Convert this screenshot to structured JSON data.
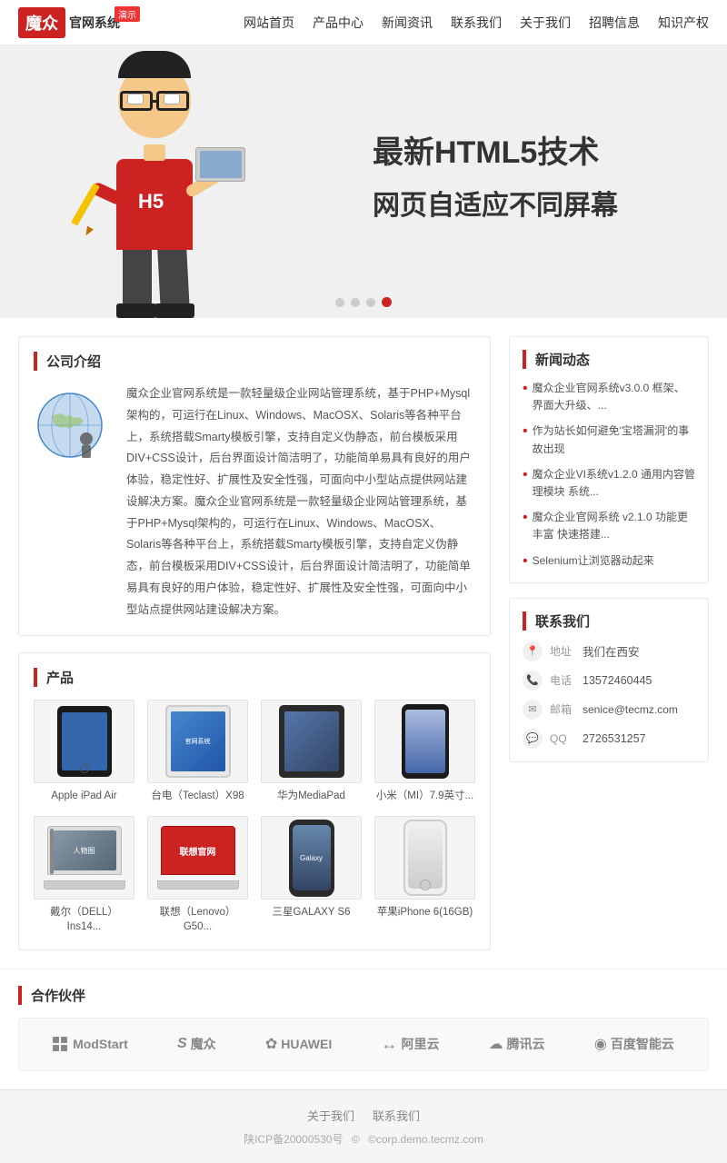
{
  "header": {
    "logo_text": "魔众",
    "logo_sub": "官网系统",
    "logo_demo": "演示",
    "nav": [
      {
        "label": "网站首页",
        "id": "home"
      },
      {
        "label": "产品中心",
        "id": "products"
      },
      {
        "label": "新闻资讯",
        "id": "news"
      },
      {
        "label": "联系我们",
        "id": "contact"
      },
      {
        "label": "关于我们",
        "id": "about"
      },
      {
        "label": "招聘信息",
        "id": "jobs"
      },
      {
        "label": "知识产权",
        "id": "ip"
      }
    ]
  },
  "hero": {
    "line1": "最新HTML5技术",
    "line2": "网页自适应不同屏幕"
  },
  "company": {
    "title": "公司介绍",
    "text": "魔众企业官网系统是一款轻量级企业网站管理系统，基于PHP+Mysql架构的，可运行在Linux、Windows、MacOSX、Solaris等各种平台上，系统搭载Smarty模板引擎，支持自定义伪静态，前台模板采用DIV+CSS设计，后台界面设计简洁明了，功能简单易具有良好的用户体验，稳定性好、扩展性及安全性强，可面向中小型站点提供网站建设解决方案。魔众企业官网系统是一款轻量级企业网站管理系统，基于PHP+Mysql架构的，可运行在Linux、Windows、MacOSX、Solaris等各种平台上，系统搭载Smarty模板引擎，支持自定义伪静态，前台模板采用DIV+CSS设计，后台界面设计简洁明了，功能简单易具有良好的用户体验，稳定性好、扩展性及安全性强，可面向中小型站点提供网站建设解决方案。"
  },
  "products_section": {
    "title": "产品",
    "items": [
      {
        "name": "Apple iPad Air",
        "type": "ipad-dark"
      },
      {
        "name": "台电（Teclast）X98",
        "type": "tablet-white"
      },
      {
        "name": "华为MediaPad",
        "type": "tablet-white2"
      },
      {
        "name": "小米（MI）7.9英寸...",
        "type": "phone-dark"
      },
      {
        "name": "戴尔（DELL）Ins14...",
        "type": "laptop"
      },
      {
        "name": "联想（Lenovo）G50...",
        "type": "laptop2"
      },
      {
        "name": "三星GALAXY S6",
        "type": "phone-samsung"
      },
      {
        "name": "苹果iPhone 6(16GB)",
        "type": "phone-iphone"
      }
    ]
  },
  "news_section": {
    "title": "新闻动态",
    "items": [
      {
        "text": "魔众企业官网系统v3.0.0 框架、界面大升级、..."
      },
      {
        "text": "作为站长如何避免'宝塔漏洞'的事故出现"
      },
      {
        "text": "魔众企业VI系统v1.2.0 通用内容管理模块 系统..."
      },
      {
        "text": "魔众企业官网系统 v2.1.0 功能更丰富 快速搭建..."
      },
      {
        "text": "Selenium让浏览器动起来"
      }
    ]
  },
  "contact_section": {
    "title": "联系我们",
    "address_label": "地址",
    "address_value": "我们在西安",
    "phone_label": "电话",
    "phone_value": "13572460445",
    "email_label": "邮箱",
    "email_value": "senice@tecmz.com",
    "qq_label": "QQ",
    "qq_value": "2726531257"
  },
  "partners": {
    "title": "合作伙伴",
    "items": [
      {
        "name": "ModStart",
        "symbol": "⊞"
      },
      {
        "name": "魔众",
        "symbol": "S"
      },
      {
        "name": "HUAWEI",
        "symbol": "❀"
      },
      {
        "name": "阿里云",
        "symbol": "↔"
      },
      {
        "name": "腾讯云",
        "symbol": "☁"
      },
      {
        "name": "百度智能云",
        "symbol": "◉"
      }
    ]
  },
  "footer": {
    "links": [
      {
        "label": "关于我们"
      },
      {
        "label": "联系我们"
      }
    ],
    "icp": "陕ICP备20000530号",
    "copyright": "©corp.demo.tecmz.com"
  }
}
